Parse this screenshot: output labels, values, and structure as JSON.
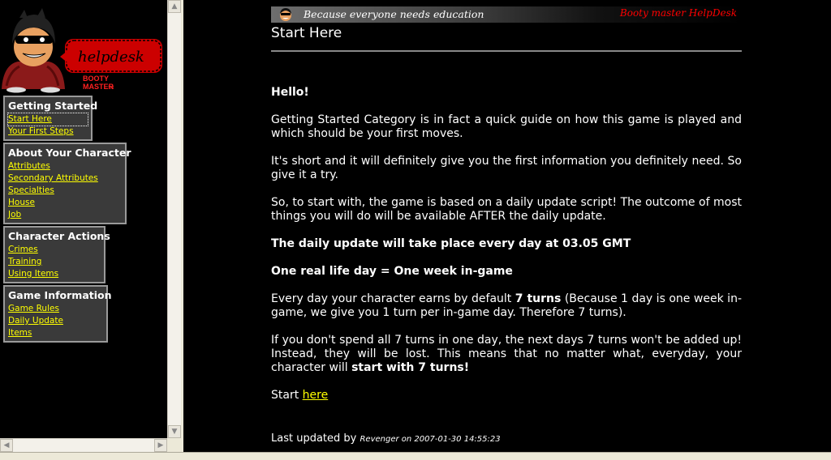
{
  "logo": {
    "helpdesk_text": "helpdesk",
    "brand_line1": "BOOTY",
    "brand_line2": "MASTER",
    "tm": "TM"
  },
  "menu": [
    {
      "title": "Getting Started",
      "items": [
        "Start Here",
        "Your First Steps"
      ],
      "active_index": 0
    },
    {
      "title": "About Your Character",
      "items": [
        "Attributes",
        "Secondary Attributes",
        "Specialties",
        "House",
        "Job"
      ]
    },
    {
      "title": "Character Actions",
      "items": [
        "Crimes",
        "Training",
        "Using Items"
      ]
    },
    {
      "title": "Game Information",
      "items": [
        "Game Rules",
        "Daily Update",
        "Items"
      ]
    }
  ],
  "banner": {
    "tagline": "Because everyone needs education",
    "right_text": "Booty master HelpDesk"
  },
  "page": {
    "title": "Start Here",
    "greeting": "Hello!",
    "p1": "Getting Started Category is in fact a quick guide on how this game is played and which should be your first moves.",
    "p2": "It's short and it will definitely give you the first information you definitely need. So give it a try.",
    "p3": "So, to start with, the game is based on a daily update script! The outcome of most things you will do will be available AFTER the daily update.",
    "p4": "The daily update will take place every day at 03.05 GMT",
    "p5": "One real life day = One week in-game",
    "p6_a": "Every day your character earns by default ",
    "p6_b": "7 turns",
    "p6_c": " (Because 1 day is one week in-game, we give you 1 turn per in-game day. Therefore 7 turns).",
    "p7_a": "If you don't spend all 7 turns in one day, the next days 7 turns won't be added up! Instead, they will be lost. This means that no matter what, everyday, your character will ",
    "p7_b": "start with 7 turns!",
    "start_prefix": "Start ",
    "start_link": "here",
    "footer_prefix": "Last updated by ",
    "footer_by": "Revenger on 2007-01-30 14:55:23"
  },
  "colors": {
    "link": "#ffff00",
    "banner_red": "#ff0000",
    "menu_bg": "#3a3a3a"
  }
}
